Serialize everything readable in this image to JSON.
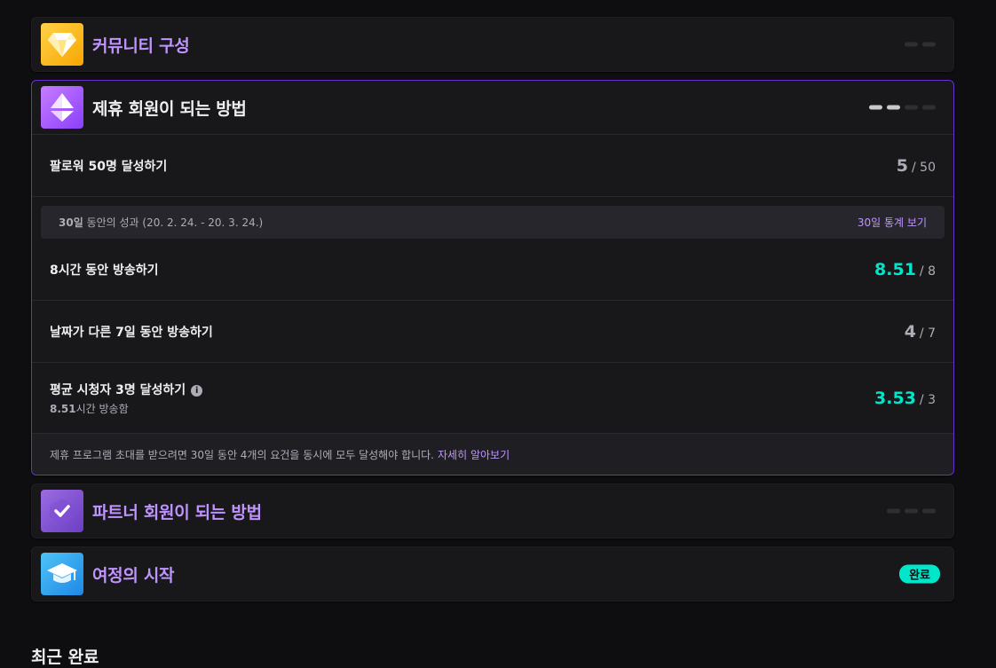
{
  "cards": {
    "community": {
      "title": "커뮤니티 구성",
      "icon": "diamond-icon",
      "progress_total": 2,
      "progress_done": 0
    },
    "affiliate": {
      "title": "제휴 회원이 되는 방법",
      "icon": "triangle-crystal-icon",
      "progress_total": 4,
      "progress_done": 2,
      "followers": {
        "label": "팔로워 50명 달성하기",
        "current": "5",
        "target": "/ 50"
      },
      "period": {
        "label_bold": "30일",
        "label_rest": " 동안의 성과 (20. 2. 24. - 20. 3. 24.)",
        "link": "30일 통계 보기"
      },
      "hours": {
        "label": "8시간 동안 방송하기",
        "current": "8.51",
        "target": "/ 8"
      },
      "days": {
        "label": "날짜가 다른 7일 동안 방송하기",
        "current": "4",
        "target": "/ 7"
      },
      "viewers": {
        "label": "평균 시청자 3명 달성하기",
        "info_glyph": "i",
        "sub_bold": "8.51",
        "sub_rest": "시간 방송함",
        "current": "3.53",
        "target": "/ 3"
      },
      "footer": {
        "text": "제휴 프로그램 초대를 받으려면 30일 동안 4개의 요건을 동시에 모두 달성해야 합니다.",
        "link": "자세히 알아보기"
      }
    },
    "partner": {
      "title": "파트너 회원이 되는 방법",
      "icon": "check-shield-icon",
      "progress_total": 3,
      "progress_done": 0
    },
    "journey": {
      "title": "여정의 시작",
      "icon": "graduation-cap-icon",
      "status": "완료"
    }
  },
  "recent_heading": "최근 완료",
  "colors": {
    "accent": "#bf94ff",
    "met": "#00e6cb",
    "border_open": "#6b2fd6"
  }
}
